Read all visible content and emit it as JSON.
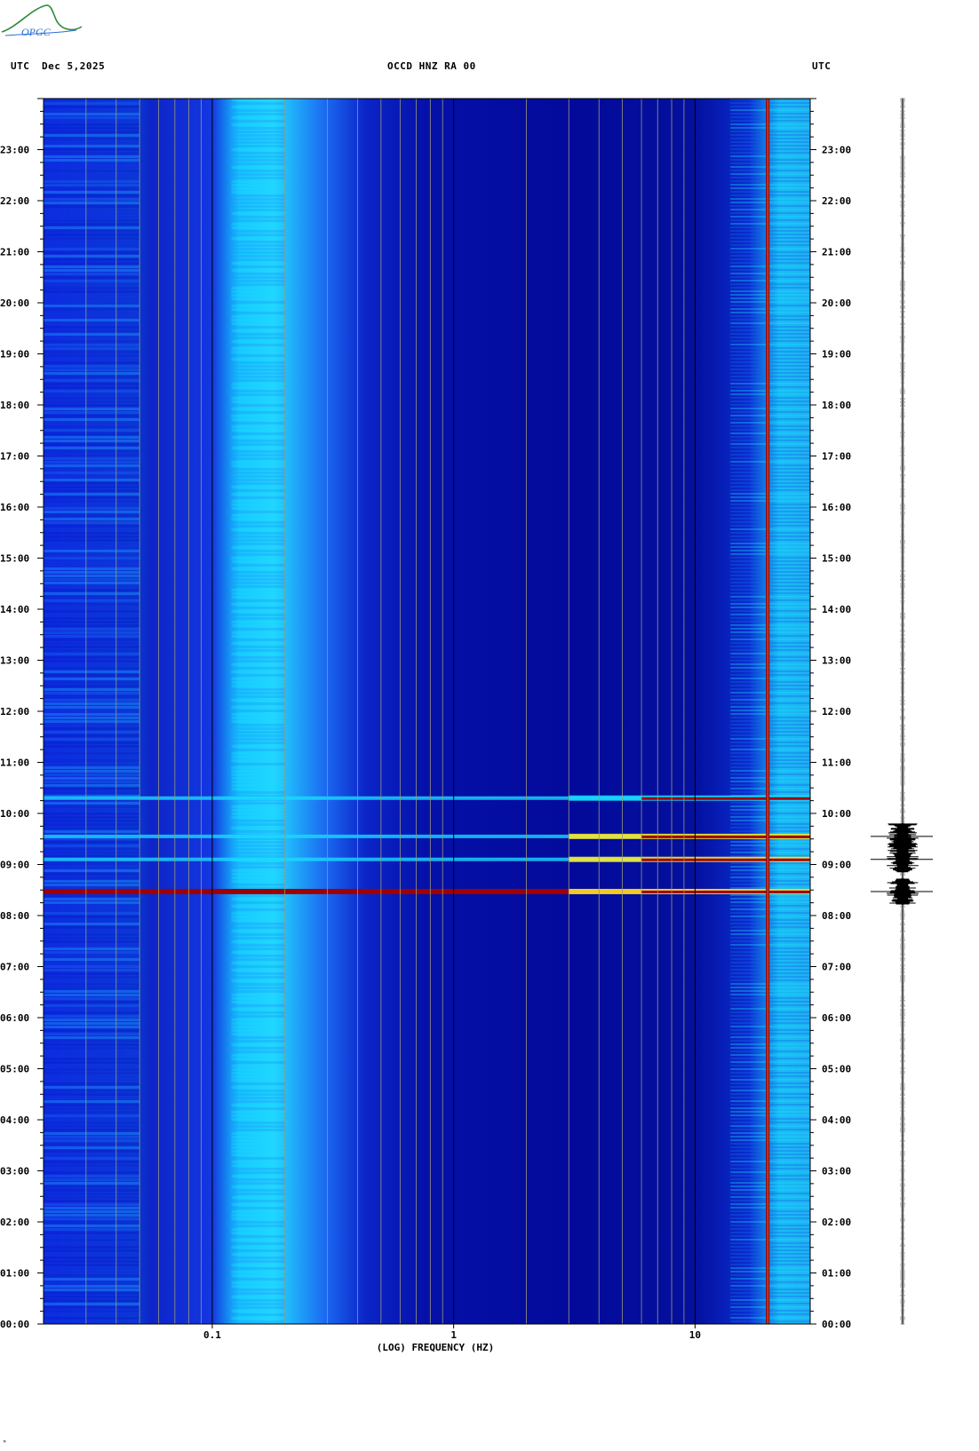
{
  "header": {
    "left_utc": "UTC",
    "date": "Dec 5,2025",
    "station": "OCCD HNZ RA 00",
    "right_utc": "UTC"
  },
  "logo": {
    "text": "OPGC"
  },
  "colors": {
    "background": "#00008f",
    "low": "#0a1fd8",
    "mid": "#19d9ff",
    "high": "#ffef2a",
    "peak": "#a00000",
    "grid": "#9a9a78"
  },
  "footer": {
    "mark": "ᴹ"
  },
  "chart_data": {
    "type": "heatmap",
    "title": "OCCD HNZ RA 00",
    "xlabel": "(LOG) FREQUENCY (HZ)",
    "x_scale": "log",
    "x_range_hz": [
      0.02,
      30
    ],
    "x_tick_labels": [
      "0.1",
      "1",
      "10"
    ],
    "x_tick_values": [
      0.1,
      1,
      10
    ],
    "y_range_hours": [
      0,
      24
    ],
    "y_tick_labels_left": [
      "00:00",
      "01:00",
      "02:00",
      "03:00",
      "04:00",
      "05:00",
      "06:00",
      "07:00",
      "08:00",
      "09:00",
      "10:00",
      "11:00",
      "12:00",
      "13:00",
      "14:00",
      "15:00",
      "16:00",
      "17:00",
      "18:00",
      "19:00",
      "20:00",
      "21:00",
      "22:00",
      "23:00"
    ],
    "y_tick_labels_right": [
      "00:00",
      "01:00",
      "02:00",
      "03:00",
      "04:00",
      "05:00",
      "06:00",
      "07:00",
      "08:00",
      "09:00",
      "10:00",
      "11:00",
      "12:00",
      "13:00",
      "14:00",
      "15:00",
      "16:00",
      "17:00",
      "18:00",
      "19:00",
      "20:00",
      "21:00",
      "22:00",
      "23:00"
    ],
    "grid": true,
    "events_utc_hours": [
      8.47,
      9.1,
      9.55,
      10.3
    ],
    "persistent_line_hz": 20,
    "microseism_band_hz": [
      0.12,
      0.3
    ],
    "seismogram_trace": true
  }
}
